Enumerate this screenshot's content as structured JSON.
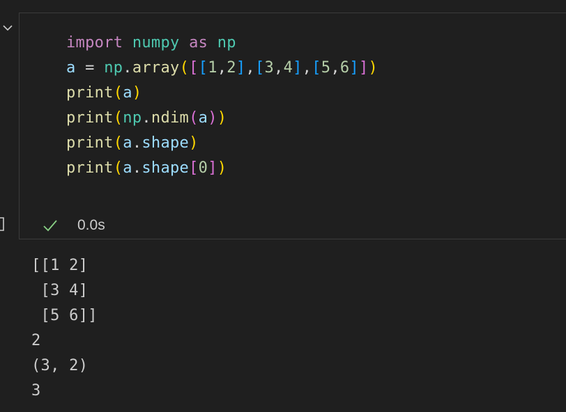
{
  "cell": {
    "code_lines": [
      [
        {
          "t": "import",
          "c": "kw"
        },
        {
          "t": " ",
          "c": "op"
        },
        {
          "t": "numpy",
          "c": "mod"
        },
        {
          "t": " ",
          "c": "op"
        },
        {
          "t": "as",
          "c": "kw"
        },
        {
          "t": " ",
          "c": "op"
        },
        {
          "t": "np",
          "c": "mod"
        }
      ],
      [
        {
          "t": "a",
          "c": "var"
        },
        {
          "t": " = ",
          "c": "op"
        },
        {
          "t": "np",
          "c": "mod"
        },
        {
          "t": ".",
          "c": "op"
        },
        {
          "t": "array",
          "c": "fn"
        },
        {
          "t": "(",
          "c": "b1"
        },
        {
          "t": "[",
          "c": "b2"
        },
        {
          "t": "[",
          "c": "b3"
        },
        {
          "t": "1",
          "c": "num"
        },
        {
          "t": ",",
          "c": "op"
        },
        {
          "t": "2",
          "c": "num"
        },
        {
          "t": "]",
          "c": "b3"
        },
        {
          "t": ",",
          "c": "op"
        },
        {
          "t": "[",
          "c": "b3"
        },
        {
          "t": "3",
          "c": "num"
        },
        {
          "t": ",",
          "c": "op"
        },
        {
          "t": "4",
          "c": "num"
        },
        {
          "t": "]",
          "c": "b3"
        },
        {
          "t": ",",
          "c": "op"
        },
        {
          "t": "[",
          "c": "b3"
        },
        {
          "t": "5",
          "c": "num"
        },
        {
          "t": ",",
          "c": "op"
        },
        {
          "t": "6",
          "c": "num"
        },
        {
          "t": "]",
          "c": "b3"
        },
        {
          "t": "]",
          "c": "b2"
        },
        {
          "t": ")",
          "c": "b1"
        }
      ],
      [
        {
          "t": "print",
          "c": "fn"
        },
        {
          "t": "(",
          "c": "b1"
        },
        {
          "t": "a",
          "c": "var"
        },
        {
          "t": ")",
          "c": "b1"
        }
      ],
      [
        {
          "t": "print",
          "c": "fn"
        },
        {
          "t": "(",
          "c": "b1"
        },
        {
          "t": "np",
          "c": "mod"
        },
        {
          "t": ".",
          "c": "op"
        },
        {
          "t": "ndim",
          "c": "fn"
        },
        {
          "t": "(",
          "c": "b2"
        },
        {
          "t": "a",
          "c": "var"
        },
        {
          "t": ")",
          "c": "b2"
        },
        {
          "t": ")",
          "c": "b1"
        }
      ],
      [
        {
          "t": "print",
          "c": "fn"
        },
        {
          "t": "(",
          "c": "b1"
        },
        {
          "t": "a",
          "c": "var"
        },
        {
          "t": ".",
          "c": "op"
        },
        {
          "t": "shape",
          "c": "var"
        },
        {
          "t": ")",
          "c": "b1"
        }
      ],
      [
        {
          "t": "print",
          "c": "fn"
        },
        {
          "t": "(",
          "c": "b1"
        },
        {
          "t": "a",
          "c": "var"
        },
        {
          "t": ".",
          "c": "op"
        },
        {
          "t": "shape",
          "c": "var"
        },
        {
          "t": "[",
          "c": "b2"
        },
        {
          "t": "0",
          "c": "num"
        },
        {
          "t": "]",
          "c": "b2"
        },
        {
          "t": ")",
          "c": "b1"
        }
      ]
    ],
    "execution_time": "0.0s",
    "status_icon": "check-icon",
    "status_color": "#89d185"
  },
  "output": {
    "lines": [
      "[[1 2]",
      " [3 4]",
      " [5 6]]",
      "2",
      "(3, 2)",
      "3"
    ]
  },
  "colors": {
    "background": "#1f1f1f",
    "cell_border": "#3c3c3c",
    "text": "#cccccc",
    "keyword": "#c586c0",
    "module": "#4ec9b0",
    "variable": "#9cdcfe",
    "function": "#dcdcaa",
    "number": "#b5cea8",
    "bracket_level_1": "#ffd700",
    "bracket_level_2": "#da70d6",
    "bracket_level_3": "#179fff"
  }
}
